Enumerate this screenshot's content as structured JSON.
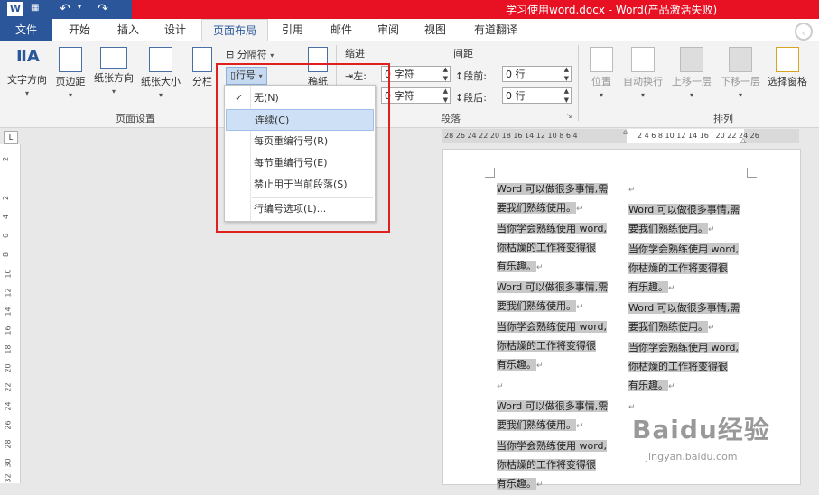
{
  "title": {
    "text": "学习使用word.docx - Word(产品激活失败)"
  },
  "tabs": [
    "文件",
    "开始",
    "插入",
    "设计",
    "页面布局",
    "引用",
    "邮件",
    "审阅",
    "视图",
    "有道翻译"
  ],
  "ribbon": {
    "page_setup": {
      "text_direction": "文字方向",
      "margins": "页边距",
      "orientation": "纸张方向",
      "size": "纸张大小",
      "columns": "分栏",
      "breaks": "分隔符",
      "line_numbers": "行号",
      "hyphenation": "稿纸",
      "group_label": "页面设置"
    },
    "paragraph": {
      "indent_label": "缩进",
      "spacing_label": "间距",
      "left": "左:",
      "right": "右:",
      "left_value": "0 字符",
      "right_value": "0 字符",
      "before": "段前:",
      "after": "段后:",
      "before_value": "0 行",
      "after_value": "0 行",
      "group_label": "段落"
    },
    "arrange": {
      "position": "位置",
      "wrap": "自动换行",
      "forward": "上移一层",
      "backward": "下移一层",
      "selection_pane": "选择窗格",
      "group_label": "排列"
    }
  },
  "dropdown": {
    "items": [
      "无(N)",
      "连续(C)",
      "每页重编行号(R)",
      "每节重编行号(E)",
      "禁止用于当前段落(S)",
      "行编号选项(L)..."
    ],
    "checked_index": 0,
    "highlighted_index": 1
  },
  "ruler": {
    "h_left": "28 26 24 22 20 18 16 14 12 10 8 6 4",
    "h_right": "2 4 6 8 10 12 14 16   20 22 24 26",
    "v": [
      "2",
      "2",
      "4",
      "6",
      "8",
      "10",
      "12",
      "14",
      "16",
      "18",
      "20",
      "22",
      "24",
      "26",
      "28",
      "30",
      "32"
    ]
  },
  "document": {
    "line1": "Word 可以做很多事情,需",
    "line2": "要我们熟练使用。",
    "line3": "当你学会熟练使用 word,",
    "line4": "你枯燥的工作将变得很",
    "line5": "有乐趣。",
    "pilcrow": "↵"
  },
  "watermark": {
    "brand": "Baidu经验",
    "url": "jingyan.baidu.com"
  }
}
